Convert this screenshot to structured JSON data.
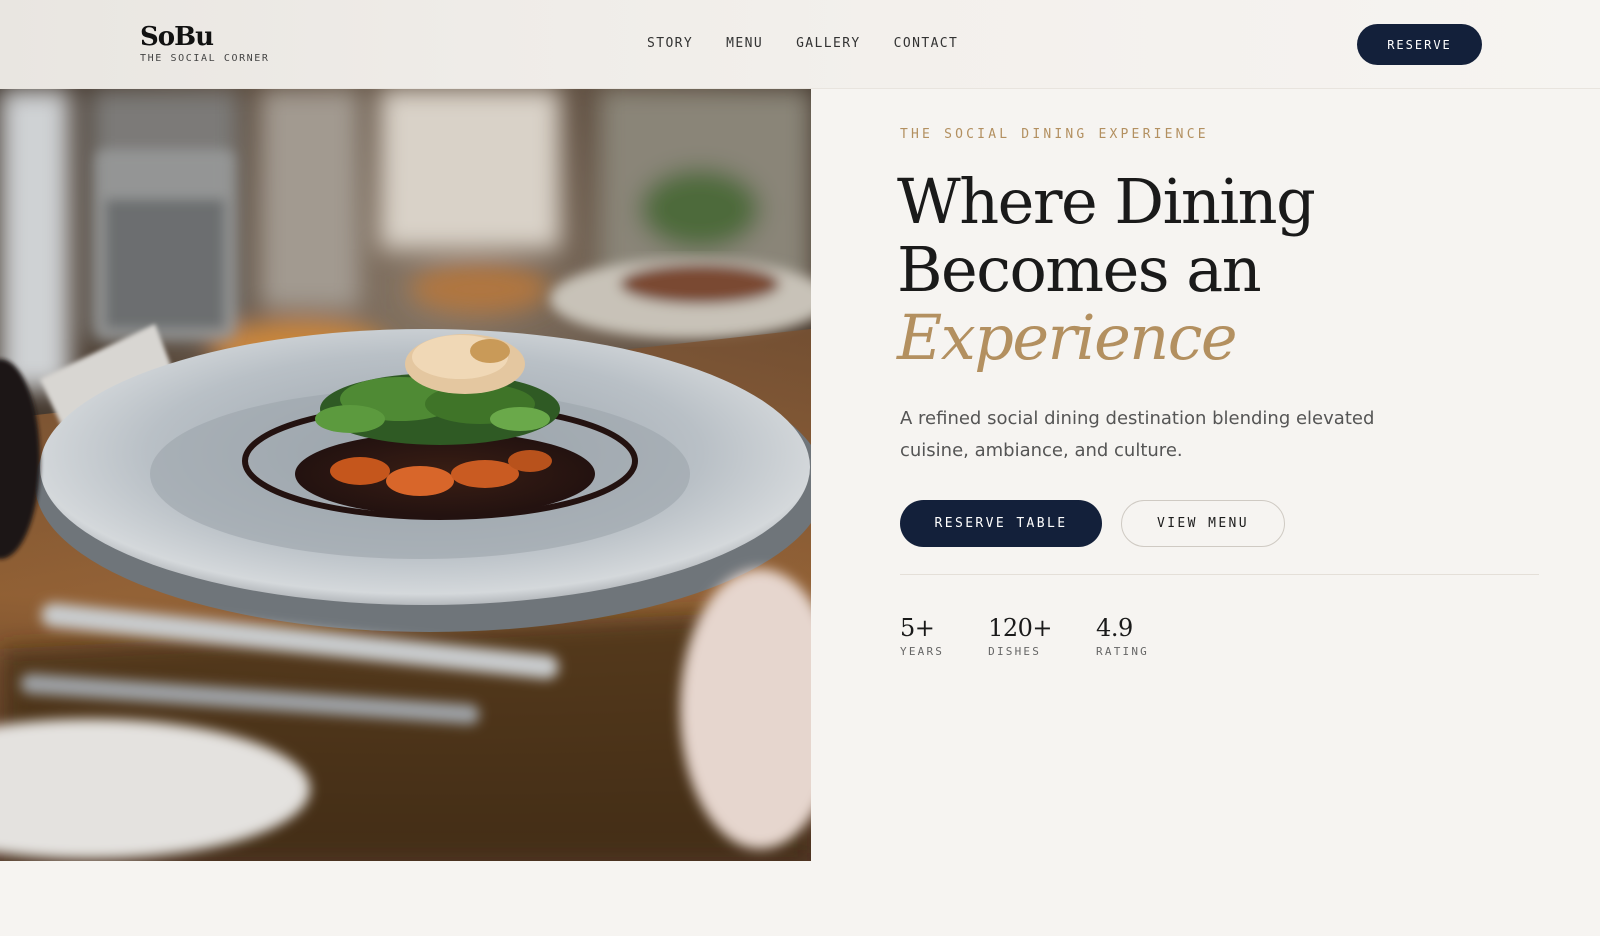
{
  "brand": {
    "name": "SoBu",
    "tagline": "THE SOCIAL CORNER"
  },
  "nav": {
    "items": [
      "STORY",
      "MENU",
      "GALLERY",
      "CONTACT"
    ],
    "reserve_label": "RESERVE"
  },
  "hero": {
    "image_icon": "plated-dish-photo",
    "eyebrow": "THE SOCIAL DINING EXPERIENCE",
    "headline_line1": "Where Dining",
    "headline_line2": "Becomes an",
    "headline_accent": "Experience",
    "description": "A refined social dining destination blending elevated cuisine, ambiance, and culture.",
    "primary_cta": "RESERVE TABLE",
    "secondary_cta": "VIEW MENU",
    "stats": [
      {
        "value": "5+",
        "label": "YEARS"
      },
      {
        "value": "120+",
        "label": "DISHES"
      },
      {
        "value": "4.9",
        "label": "RATING"
      }
    ]
  },
  "colors": {
    "background": "#f6f4f1",
    "navy": "#13203a",
    "gold_accent": "#b39060",
    "text_dark": "#1a1a1a",
    "text_muted": "#555555"
  }
}
